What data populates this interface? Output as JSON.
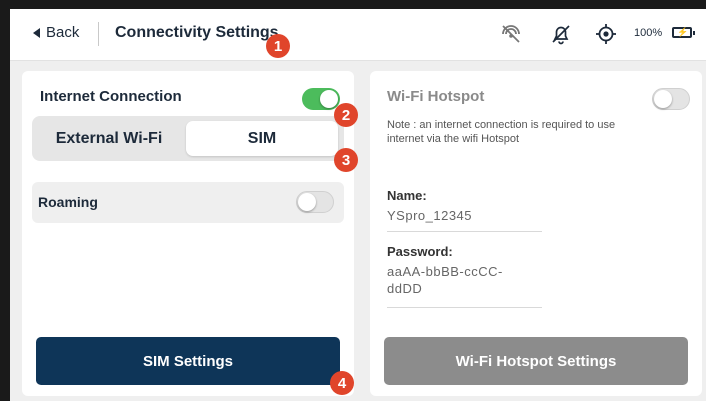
{
  "header": {
    "back_label": "Back",
    "title": "Connectivity Settings",
    "battery_percent": "100%",
    "icons": [
      "signal-off-icon",
      "bell-off-icon",
      "location-icon",
      "battery-charging-icon"
    ]
  },
  "internet": {
    "label": "Internet Connection",
    "enabled": true,
    "options": [
      "External Wi-Fi",
      "SIM"
    ],
    "selected": "SIM",
    "roaming_label": "Roaming",
    "roaming_enabled": false,
    "sim_settings_button": "SIM Settings"
  },
  "hotspot": {
    "label": "Wi-Fi Hotspot",
    "enabled": false,
    "note": "Note : an internet connection is required to use internet via the wifi Hotspot",
    "name_label": "Name:",
    "name_value": "YSpro_12345",
    "password_label": "Password:",
    "password_line1": "aaAA-bbBB-ccCC-",
    "password_line2": "ddDD",
    "settings_button": "Wi-Fi Hotspot Settings"
  },
  "callouts": [
    "1",
    "2",
    "3",
    "4"
  ],
  "colors": {
    "accent_navy": "#0e3558",
    "toggle_on": "#4cbc5c",
    "disabled_button": "#8c8c8c",
    "callout_red": "#e0452b"
  }
}
